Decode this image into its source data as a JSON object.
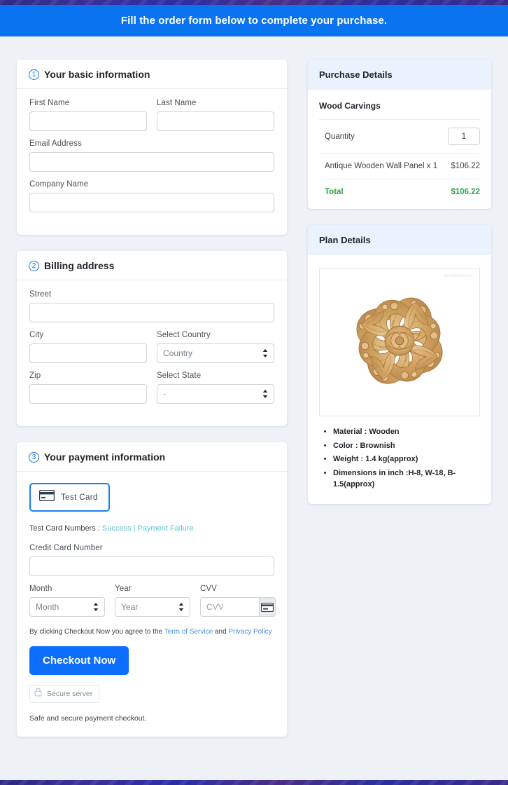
{
  "banner": {
    "text": "Fill the order form below to complete your purchase."
  },
  "sections": {
    "basic": {
      "step": "1",
      "title": "Your basic information",
      "fields": {
        "first_name_label": "First Name",
        "first_name_value": "",
        "last_name_label": "Last Name",
        "last_name_value": "",
        "email_label": "Email Address",
        "email_value": "",
        "company_label": "Company Name",
        "company_value": ""
      }
    },
    "billing": {
      "step": "2",
      "title": "Billing address",
      "fields": {
        "street_label": "Street",
        "street_value": "",
        "city_label": "City",
        "city_value": "",
        "country_label": "Select Country",
        "country_value": "Country",
        "zip_label": "Zip",
        "zip_value": "",
        "state_label": "Select State",
        "state_value": "-"
      }
    },
    "payment": {
      "step": "3",
      "title": "Your payment information",
      "card_tab_label": "Test  Card",
      "test_numbers_prefix": "Test Card Numbers : ",
      "test_success_link": "Success",
      "test_separator": "|",
      "test_failure_link": "Payment Failure",
      "cc_label": "Credit Card Number",
      "cc_value": "",
      "month_label": "Month",
      "month_value": "Month",
      "year_label": "Year",
      "year_value": "Year",
      "cvv_label": "CVV",
      "cvv_placeholder": "CVV",
      "terms_prefix": "By clicking Checkout Now you agree to the ",
      "terms_link": "Term of Service",
      "terms_and": " and ",
      "privacy_link": "Privacy Policy",
      "checkout_label": "Checkout Now",
      "secure_label": "Secure server",
      "safe_note": "Safe and secure payment checkout."
    }
  },
  "purchase": {
    "title": "Purchase Details",
    "product_group": "Wood Carvings",
    "quantity_label": "Quantity",
    "quantity_value": "1",
    "line_item": "Antique Wooden Wall Panel x 1",
    "line_price": "$106.22",
    "total_label": "Total",
    "total_price": "$106.22",
    "total_color": "#28a745"
  },
  "plan": {
    "title": "Plan Details",
    "image_watermark": "woodcarvings",
    "specs": [
      "Material : Wooden",
      "Color : Brownish",
      "Weight : 1.4 kg(approx)",
      "Dimensions in inch :H-8, W-18, B-1.5(approx)"
    ]
  },
  "theme": {
    "banner_bg": "#0a74f0",
    "accent": "#0d6efd",
    "link": "#4a90e2",
    "teal_link": "#5ac4d4",
    "panel_head_bg": "#eaf2fd",
    "page_bg": "#eef2f7"
  }
}
